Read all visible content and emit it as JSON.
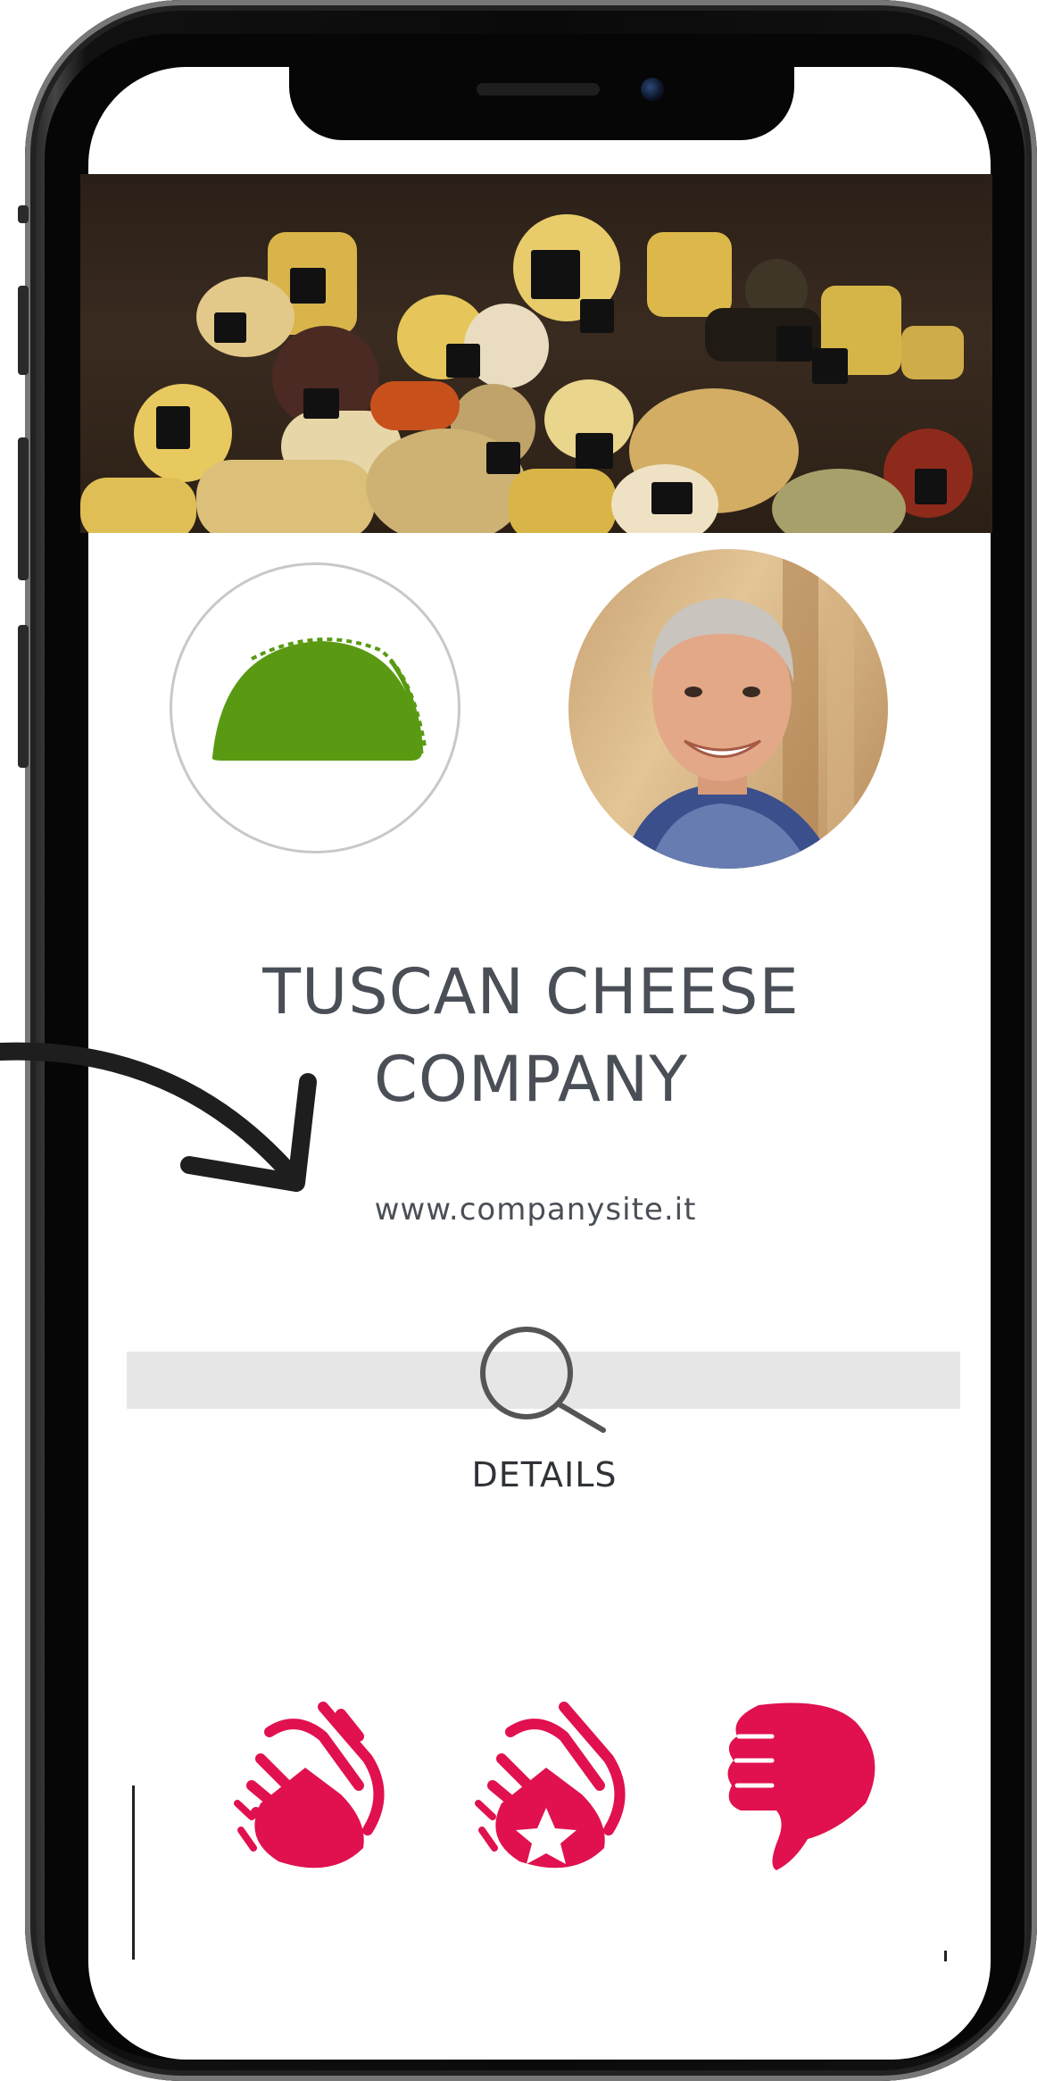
{
  "profile": {
    "company_name_line1": "TUSCAN CHEESE",
    "company_name_line2": "COMPANY",
    "website": "www.companysite.it"
  },
  "details": {
    "label": "DETAILS"
  },
  "reactions": [
    {
      "name": "applause"
    },
    {
      "name": "applause-star"
    },
    {
      "name": "thumbs-down"
    }
  ],
  "colors": {
    "accent_reaction": "#e0114e",
    "logo_green": "#5a9a13",
    "text_gray": "#4a4f57"
  },
  "icons": [
    "taco-logo-icon",
    "search-icon",
    "clapping-hands-icon",
    "clapping-hands-star-icon",
    "thumbs-down-icon",
    "arrow-icon"
  ]
}
